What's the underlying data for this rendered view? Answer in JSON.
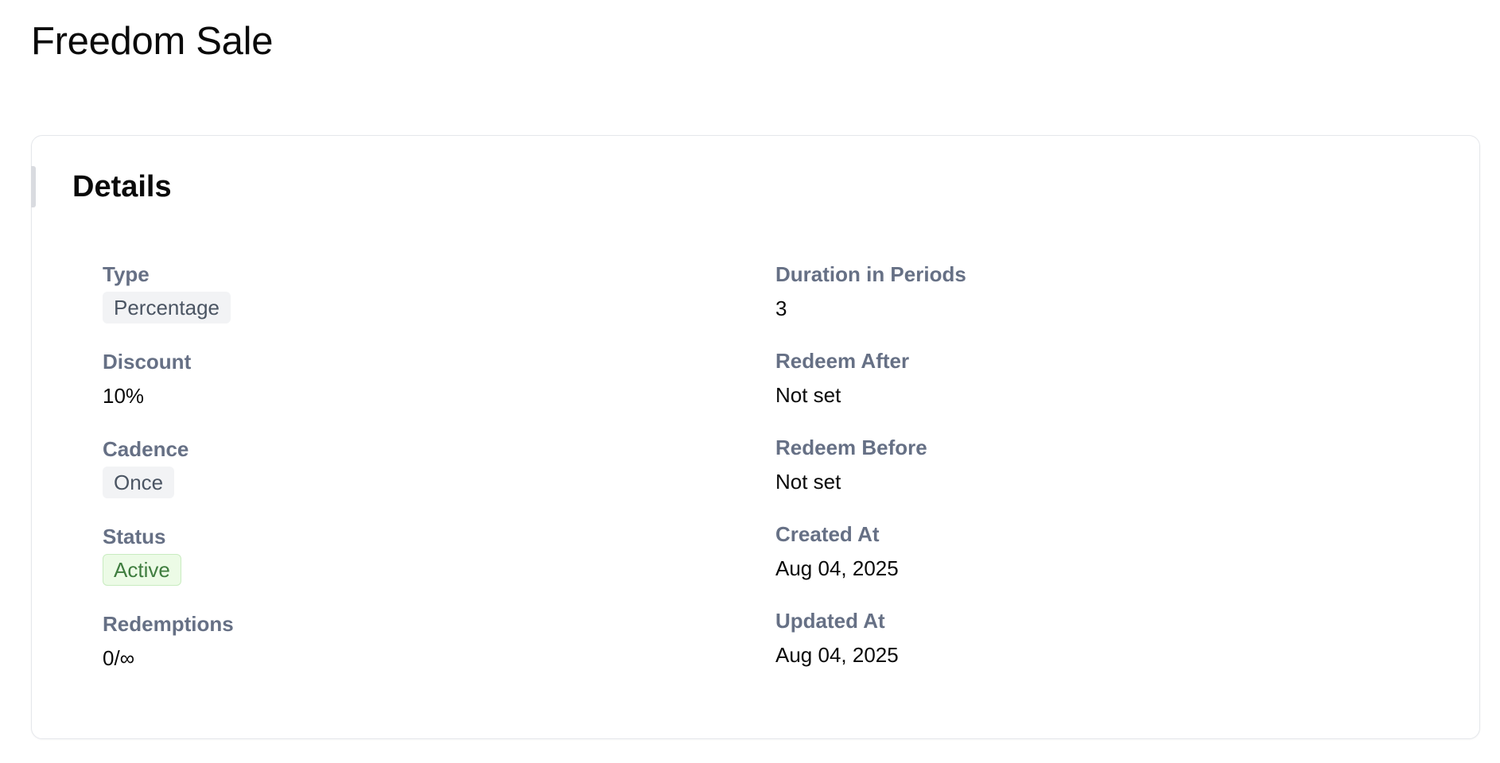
{
  "page": {
    "title": "Freedom Sale"
  },
  "details": {
    "title": "Details",
    "left": [
      {
        "label": "Type",
        "value": "Percentage",
        "style": "badge-neutral"
      },
      {
        "label": "Discount",
        "value": "10%",
        "style": "text"
      },
      {
        "label": "Cadence",
        "value": "Once",
        "style": "badge-neutral"
      },
      {
        "label": "Status",
        "value": "Active",
        "style": "badge-success"
      },
      {
        "label": "Redemptions",
        "value": "0/∞",
        "style": "text"
      }
    ],
    "right": [
      {
        "label": "Duration in Periods",
        "value": "3",
        "style": "text"
      },
      {
        "label": "Redeem After",
        "value": "Not set",
        "style": "text"
      },
      {
        "label": "Redeem Before",
        "value": "Not set",
        "style": "text"
      },
      {
        "label": "Created At",
        "value": "Aug 04, 2025",
        "style": "text"
      },
      {
        "label": "Updated At",
        "value": "Aug 04, 2025",
        "style": "text"
      }
    ]
  },
  "colors": {
    "label": "#667085",
    "badge_neutral_bg": "#f2f3f5",
    "badge_success_bg": "#ecfbe6",
    "badge_success_text": "#3f7d3f"
  }
}
